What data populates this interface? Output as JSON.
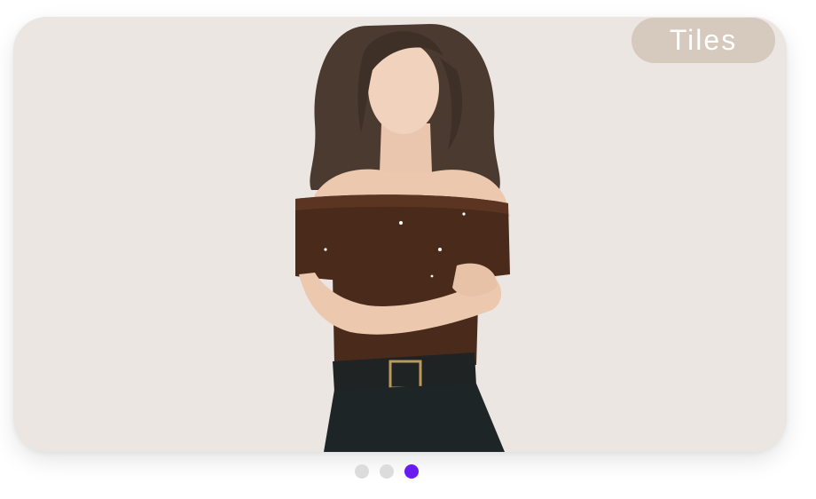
{
  "carousel": {
    "badge_label": "Tiles",
    "slide_image_icon": "woman-off-shoulder-sweater-photo",
    "dots_total": 3,
    "active_dot": 3
  },
  "colors": {
    "card_background": "#ebe6e1",
    "badge_background": "#d6c9bd",
    "badge_text": "#ffffff",
    "dot_inactive": "#dcdcdc",
    "dot_active": "#6a1bf0"
  }
}
